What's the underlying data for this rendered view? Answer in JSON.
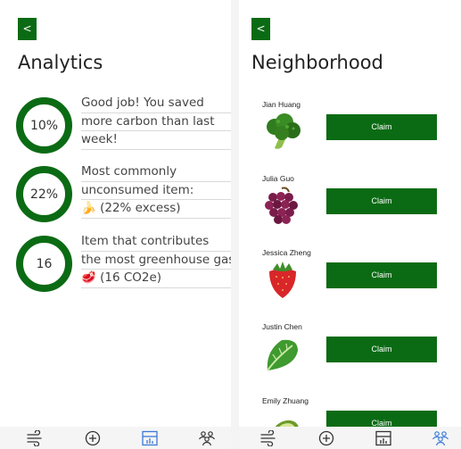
{
  "analytics": {
    "back_label": "<",
    "title": "Analytics",
    "stats": [
      {
        "ring_value": "10%",
        "lines": [
          "Good job! You saved",
          "more carbon than last",
          "week!"
        ]
      },
      {
        "ring_value": "22%",
        "lines": [
          "Most commonly",
          "unconsumed item:",
          "🍌 (22% excess)"
        ]
      },
      {
        "ring_value": "16",
        "lines": [
          "Item that contributes",
          "the most greenhouse gas:",
          "🥩 (16 CO2e)"
        ]
      }
    ]
  },
  "neighborhood": {
    "back_label": "<",
    "title": "Neighborhood",
    "items": [
      {
        "name": "Jian Huang",
        "produce": "broccoli-icon",
        "claim_label": "Claim"
      },
      {
        "name": "Julia Guo",
        "produce": "grapes-icon",
        "claim_label": "Claim"
      },
      {
        "name": "Jessica Zheng",
        "produce": "strawberry-icon",
        "claim_label": "Claim"
      },
      {
        "name": "Justin Chen",
        "produce": "lettuce-icon",
        "claim_label": "Claim"
      },
      {
        "name": "Emily Zhuang",
        "produce": "avocado-icon",
        "claim_label": "Claim"
      }
    ]
  },
  "bottom_nav": {
    "left_active": "analytics-nav-icon",
    "right_active": "community-nav-icon",
    "icons": [
      "wind-icon",
      "add-circle-icon",
      "analytics-nav-icon",
      "community-nav-icon"
    ],
    "inactive_color": "#333333",
    "active_color": "#3b7ad8"
  },
  "colors": {
    "accent": "#0b6b14"
  }
}
